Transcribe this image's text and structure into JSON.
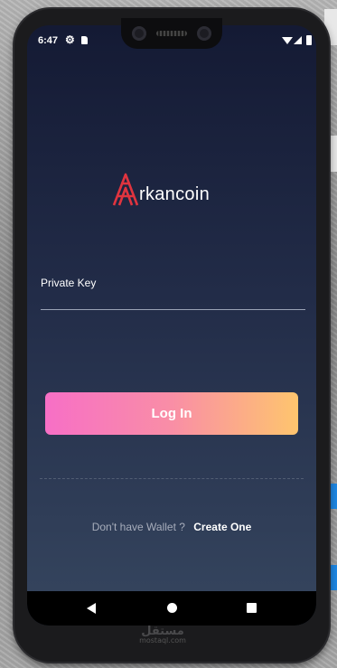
{
  "statusbar": {
    "time": "6:47"
  },
  "brand": {
    "name": "rkancoin",
    "logo_letter": "A",
    "accent_color": "#e0343f"
  },
  "form": {
    "private_key_label": "Private Key",
    "private_key_value": ""
  },
  "login_button": {
    "label": "Log In",
    "gradient": [
      "#f76fc6",
      "#fec56e"
    ]
  },
  "signup": {
    "prompt": "Don't have Wallet ?",
    "link": "Create One"
  },
  "navbar": {
    "icons": [
      "back-icon",
      "home-icon",
      "recent-apps-icon"
    ]
  },
  "watermark": {
    "text": "مستقل",
    "subtext": "mostaql.com"
  }
}
